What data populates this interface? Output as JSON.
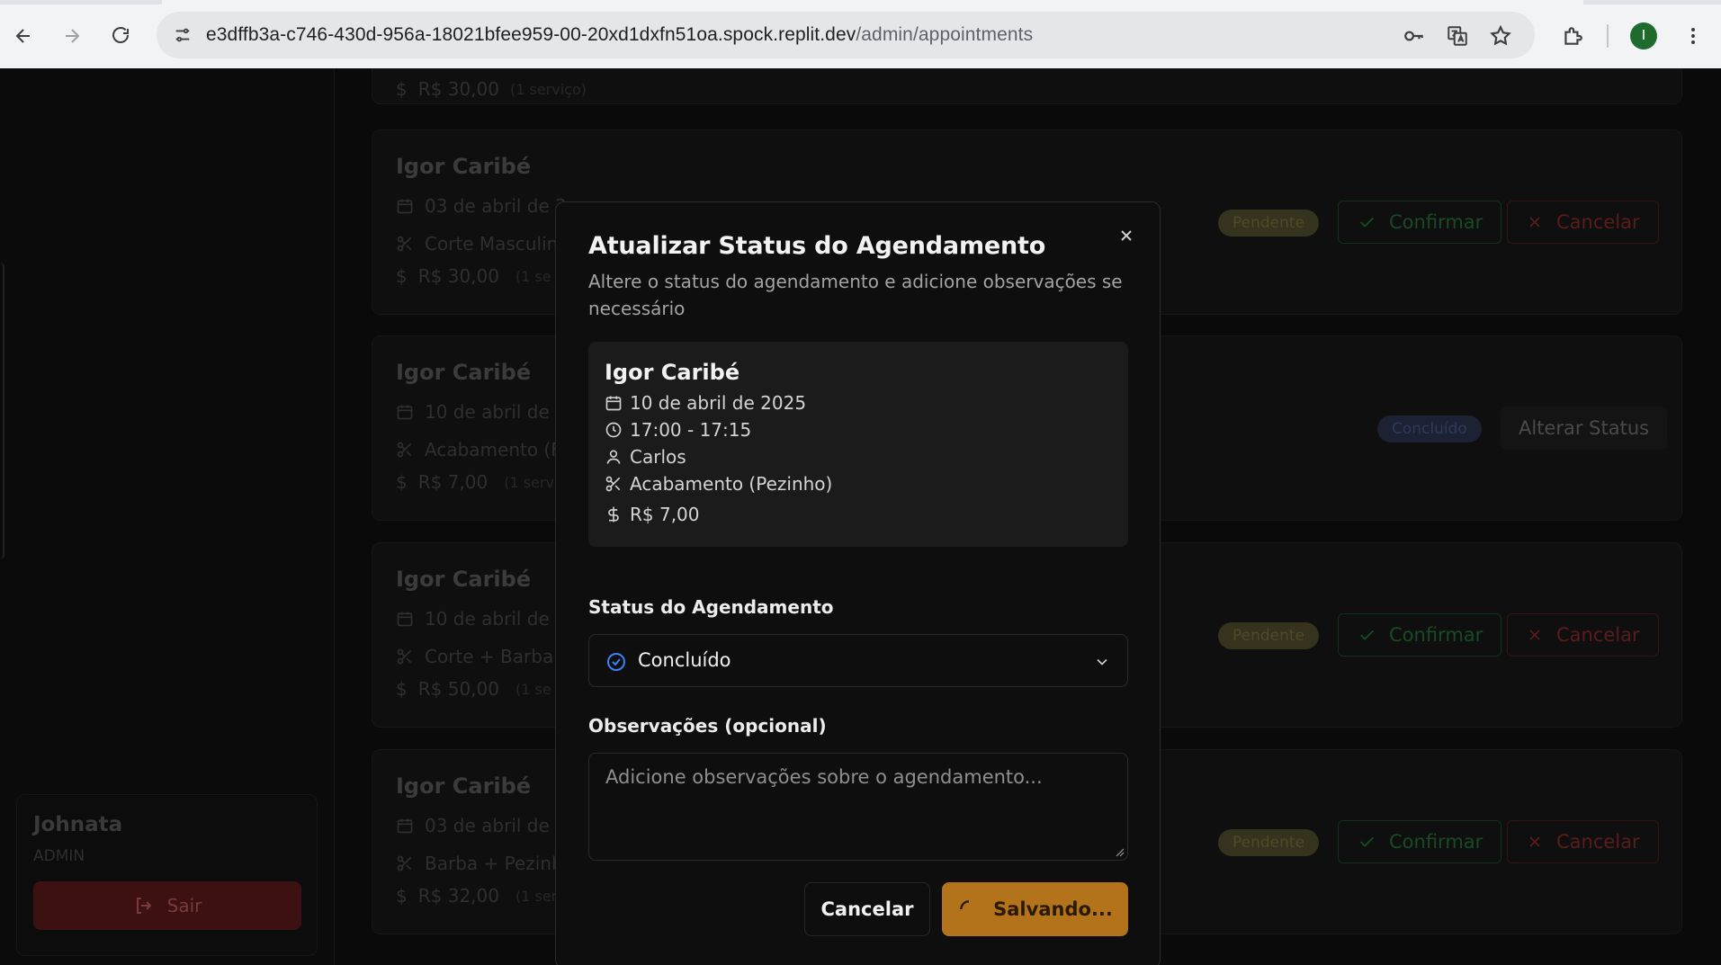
{
  "browser": {
    "url_host": "e3dffb3a-c746-430d-956a-18021bfee959-00-20xd1dxfn51oa.spock.replit.dev",
    "url_path": "/admin/appointments",
    "profile_initial": "I"
  },
  "sidebar": {
    "user_name": "Johnata",
    "user_role": "ADMIN",
    "logout_label": "Sair"
  },
  "background": {
    "top_partial": {
      "price": "R$ 30,00",
      "count": "(1 serviço)"
    },
    "cards": [
      {
        "client": "Igor Caribé",
        "date": "03 de abril de 2",
        "service": "Corte Masculin",
        "price": "R$ 30,00",
        "count": "(1 se",
        "status": "Pendente",
        "confirm": "Confirmar",
        "cancel": "Cancelar"
      },
      {
        "client": "Igor Caribé",
        "date": "10 de abril de 2",
        "service": "Acabamento (F",
        "price": "R$ 7,00",
        "count": "(1 serv",
        "status": "Concluído",
        "alter": "Alterar Status"
      },
      {
        "client": "Igor Caribé",
        "date": "10 de abril de 2",
        "service": "Corte + Barba",
        "price": "R$ 50,00",
        "count": "(1 se",
        "status": "Pendente",
        "confirm": "Confirmar",
        "cancel": "Cancelar"
      },
      {
        "client": "Igor Caribé",
        "date": "03 de abril de 2",
        "service": "Barba + Pezinh",
        "price": "R$ 32,00",
        "count": "(1 serviço)",
        "status": "Pendente",
        "confirm": "Confirmar",
        "cancel": "Cancelar"
      }
    ]
  },
  "modal": {
    "title": "Atualizar Status do Agendamento",
    "description": "Altere o status do agendamento e adicione observações se necessário",
    "appointment": {
      "client": "Igor Caribé",
      "date": "10 de abril de 2025",
      "time": "17:00 - 17:15",
      "barber": "Carlos",
      "service": "Acabamento (Pezinho)",
      "price": "R$ 7,00"
    },
    "status_label": "Status do Agendamento",
    "status_value": "Concluído",
    "notes_label": "Observações (opcional)",
    "notes_placeholder": "Adicione observações sobre o agendamento...",
    "cancel_label": "Cancelar",
    "save_label": "Salvando..."
  },
  "colors": {
    "accent_save": "#b3731a",
    "status_done_icon": "#3b82f6"
  }
}
